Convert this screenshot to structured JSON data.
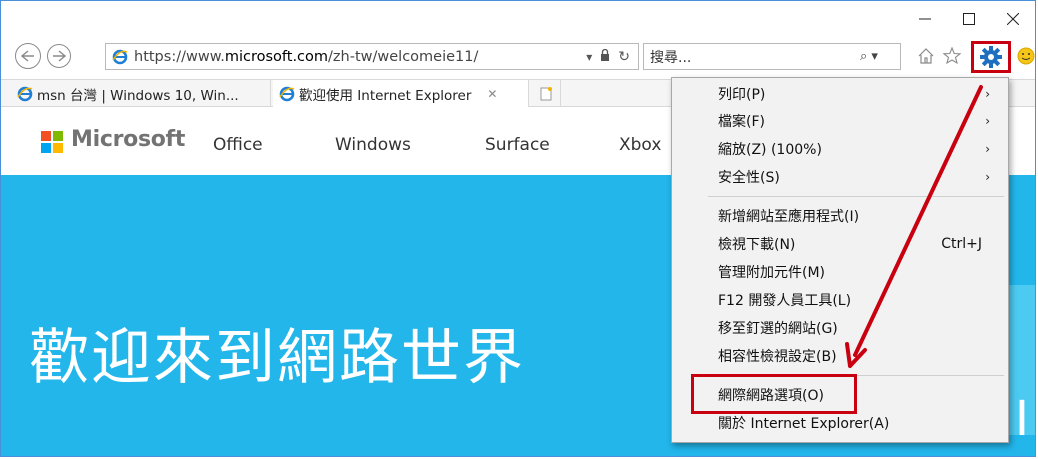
{
  "window": {
    "controls": [
      "minimize",
      "maximize",
      "close"
    ]
  },
  "nav": {
    "url_prefix": "https://www.",
    "url_domain": "microsoft.com",
    "url_path": "/zh-tw/welcomeie11/",
    "search_placeholder": "搜尋..."
  },
  "tabs": [
    {
      "label": "msn 台灣 | Windows 10, Win...",
      "active": false
    },
    {
      "label": "歡迎使用 Internet Explorer",
      "active": true
    }
  ],
  "site_header": {
    "brand": "Microsoft",
    "nav_items": [
      "Office",
      "Windows",
      "Surface",
      "Xbox"
    ]
  },
  "hero": {
    "title": "歡迎來到網路世界",
    "partial_text": "I"
  },
  "menu": {
    "items": [
      {
        "label": "列印(P)",
        "submenu": true
      },
      {
        "label": "檔案(F)",
        "submenu": true
      },
      {
        "label": "縮放(Z) (100%)",
        "submenu": true
      },
      {
        "label": "安全性(S)",
        "submenu": true
      },
      {
        "label": "新增網站至應用程式(I)"
      },
      {
        "label": "檢視下載(N)",
        "shortcut": "Ctrl+J"
      },
      {
        "label": "管理附加元件(M)"
      },
      {
        "label": "F12 開發人員工具(L)"
      },
      {
        "label": "移至釘選的網站(G)"
      },
      {
        "label": "相容性檢視設定(B)"
      },
      {
        "label": "網際網路選項(O)",
        "highlighted": true
      },
      {
        "label": "關於 Internet Explorer(A)"
      }
    ],
    "submenu_glyph": "›"
  },
  "colors": {
    "accent_red": "#c8000f",
    "hero_blue": "#22b6eb",
    "ms_red": "#f25022",
    "ms_green": "#7fba00",
    "ms_blue": "#00a4ef",
    "ms_yellow": "#ffb900"
  }
}
